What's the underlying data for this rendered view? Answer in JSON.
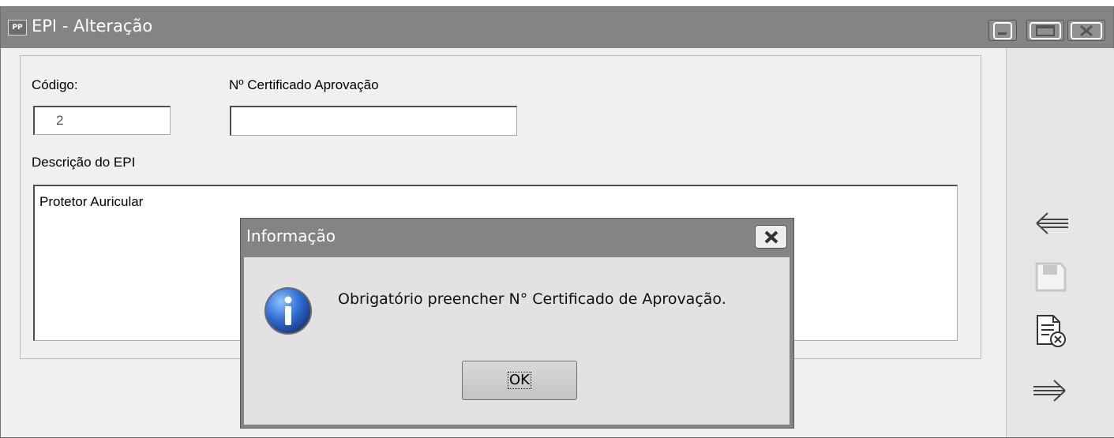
{
  "window": {
    "app_icon_text": "PP",
    "title": "EPI - Alteração"
  },
  "form": {
    "codigo_label": "Código:",
    "codigo_value": "2",
    "certificado_label": "Nº Certificado Aprovação",
    "certificado_value": "",
    "descricao_label": "Descrição do EPI",
    "descricao_value": "Protetor Auricular"
  },
  "side_toolbar": {
    "items": [
      {
        "icon": "arrow-left-icon",
        "enabled": true
      },
      {
        "icon": "save-icon",
        "enabled": false
      },
      {
        "icon": "cancel-document-icon",
        "enabled": true
      },
      {
        "icon": "arrow-right-icon",
        "enabled": true
      }
    ]
  },
  "dialog": {
    "title": "Informação",
    "message": "Obrigatório preencher N° Certificado de Aprovação.",
    "ok_label": "OK",
    "icon": "information-icon"
  },
  "colors": {
    "titlebar": "#848484",
    "window_bg": "#f0f0f0",
    "info_icon_blue": "#2c6bd0"
  }
}
